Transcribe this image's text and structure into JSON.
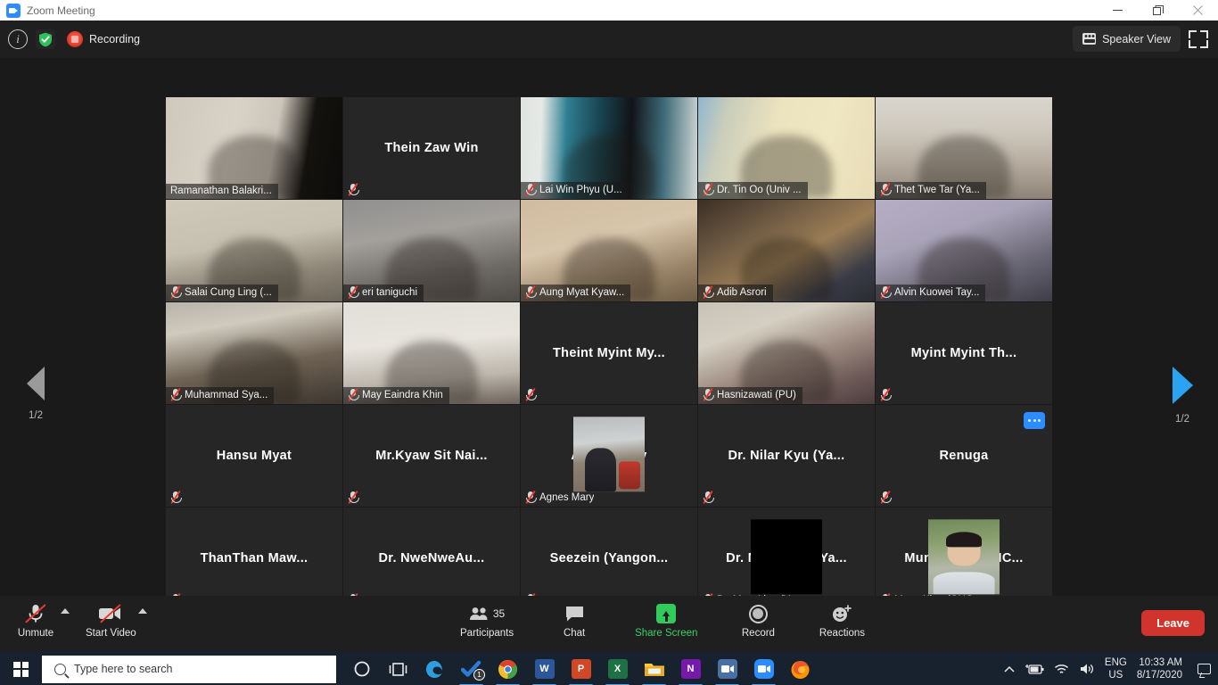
{
  "window": {
    "title": "Zoom Meeting",
    "minimize_label": "Minimize",
    "restore_label": "Restore",
    "close_label": "Close"
  },
  "header": {
    "info_icon": "info-icon",
    "encryption_icon": "shield-icon",
    "recording_label": "Recording",
    "view_mode_label": "Speaker View",
    "fullscreen_label": "Enter Full Screen"
  },
  "pager": {
    "prev_label": "1/2",
    "next_label": "1/2"
  },
  "gallery": {
    "more_options_label": "More options",
    "tiles": [
      {
        "name": "Ramanathan Balakri...",
        "video": true,
        "active": true,
        "muted": false,
        "label_shaded": true,
        "bg": "room-light"
      },
      {
        "name": "Thein Zaw Win",
        "video": false,
        "active": false,
        "muted": true,
        "label_shaded": false,
        "bg": "none"
      },
      {
        "name": "Lai Win Phyu (U...",
        "video": true,
        "active": false,
        "muted": true,
        "label_shaded": true,
        "bg": "room-teal"
      },
      {
        "name": "Dr. Tin Oo (Univ ...",
        "video": true,
        "active": false,
        "muted": true,
        "label_shaded": true,
        "bg": "room-cream"
      },
      {
        "name": "Thet Twe Tar (Ya...",
        "video": true,
        "active": false,
        "muted": true,
        "label_shaded": true,
        "bg": "room-office"
      },
      {
        "name": "Salai Cung Ling (...",
        "video": true,
        "active": false,
        "muted": true,
        "label_shaded": true,
        "bg": "room-wall"
      },
      {
        "name": "eri taniguchi",
        "video": true,
        "active": false,
        "muted": true,
        "label_shaded": true,
        "bg": "room-grey"
      },
      {
        "name": "Aung Myat Kyaw...",
        "video": true,
        "active": false,
        "muted": true,
        "label_shaded": true,
        "bg": "room-warm"
      },
      {
        "name": "Adib Asrori",
        "video": true,
        "active": false,
        "muted": true,
        "label_shaded": true,
        "bg": "room-dark"
      },
      {
        "name": "Alvin Kuowei Tay...",
        "video": true,
        "active": false,
        "muted": true,
        "label_shaded": true,
        "bg": "room-purple"
      },
      {
        "name": "Muhammad Sya...",
        "video": true,
        "active": false,
        "muted": true,
        "label_shaded": true,
        "bg": "room-class"
      },
      {
        "name": "May Eaindra Khin",
        "video": true,
        "active": false,
        "muted": true,
        "label_shaded": true,
        "bg": "room-white"
      },
      {
        "name": "Theint Myint My...",
        "video": false,
        "active": false,
        "muted": true,
        "label_shaded": false,
        "bg": "none"
      },
      {
        "name": "Hasnizawati (PU)",
        "video": true,
        "active": false,
        "muted": true,
        "label_shaded": true,
        "bg": "room-lab"
      },
      {
        "name": "Myint Myint Th...",
        "video": false,
        "active": false,
        "muted": true,
        "label_shaded": false,
        "bg": "none",
        "center_name": true
      },
      {
        "name": "Hansu Myat",
        "video": false,
        "active": false,
        "muted": true,
        "label_shaded": false,
        "bg": "none",
        "center_name": true
      },
      {
        "name": "Mr.Kyaw Sit Nai...",
        "video": false,
        "active": false,
        "muted": true,
        "label_shaded": false,
        "bg": "none",
        "center_name": true
      },
      {
        "name": "Agnes Mary",
        "video": false,
        "active": false,
        "muted": true,
        "label_shaded": false,
        "bg": "none",
        "avatar": "photo-campus"
      },
      {
        "name": "Dr. Nilar Kyu (Ya...",
        "video": false,
        "active": false,
        "muted": true,
        "label_shaded": false,
        "bg": "none",
        "center_name": true
      },
      {
        "name": "Renuga",
        "video": false,
        "active": false,
        "muted": true,
        "label_shaded": false,
        "bg": "none",
        "center_name": true,
        "more_menu": true
      },
      {
        "name": "ThanThan Maw...",
        "video": false,
        "active": false,
        "muted": true,
        "label_shaded": false,
        "bg": "none",
        "center_name": true
      },
      {
        "name": "Dr. NweNweAu...",
        "video": false,
        "active": false,
        "muted": true,
        "label_shaded": false,
        "bg": "none",
        "center_name": true
      },
      {
        "name": "Seezein (Yangon...",
        "video": false,
        "active": false,
        "muted": true,
        "label_shaded": false,
        "bg": "none",
        "center_name": true
      },
      {
        "name": "Dr. Myot Linn (Ya...",
        "video": false,
        "active": false,
        "muted": true,
        "label_shaded": false,
        "bg": "none",
        "avatar": "black-box"
      },
      {
        "name": "Mung Khat (GHC...",
        "video": false,
        "active": false,
        "muted": true,
        "label_shaded": false,
        "bg": "none",
        "avatar": "photo-man"
      }
    ]
  },
  "controls": {
    "mute": {
      "label": "Unmute",
      "icon": "microphone-muted-icon"
    },
    "video": {
      "label": "Start Video",
      "icon": "video-off-icon"
    },
    "participants": {
      "label": "Participants",
      "count": "35",
      "icon": "people-icon"
    },
    "chat": {
      "label": "Chat",
      "icon": "chat-bubble-icon"
    },
    "share": {
      "label": "Share Screen",
      "icon": "share-screen-icon",
      "color": "#3ad06a"
    },
    "record": {
      "label": "Record",
      "icon": "record-circle-icon"
    },
    "reactions": {
      "label": "Reactions",
      "icon": "smiley-plus-icon"
    },
    "leave": {
      "label": "Leave",
      "color": "#d0342c"
    }
  },
  "taskbar": {
    "start_label": "Start",
    "search_placeholder": "Type here to search",
    "cortana_label": "Cortana",
    "taskview_label": "Task View",
    "apps": [
      {
        "name": "edge-icon",
        "glyph": "e",
        "color": "#1a8ad4",
        "open": false,
        "badge": ""
      },
      {
        "name": "todo-icon",
        "glyph": "✔",
        "color": "#2b7cd3",
        "open": true,
        "badge": "1"
      },
      {
        "name": "chrome-icon",
        "glyph": "",
        "color": "#e64b3c",
        "open": true,
        "badge": ""
      },
      {
        "name": "word-icon",
        "glyph": "W",
        "color": "#2b579a",
        "open": true,
        "badge": ""
      },
      {
        "name": "powerpoint-icon",
        "glyph": "P",
        "color": "#d24726",
        "open": true,
        "badge": ""
      },
      {
        "name": "excel-icon",
        "glyph": "X",
        "color": "#1e7145",
        "open": true,
        "badge": ""
      },
      {
        "name": "file-explorer-icon",
        "glyph": "",
        "color": "#ffc83d",
        "open": true,
        "badge": ""
      },
      {
        "name": "onenote-icon",
        "glyph": "N",
        "color": "#7719aa",
        "open": true,
        "badge": ""
      },
      {
        "name": "zoom-app-icon",
        "glyph": "",
        "color": "#4a6fa5",
        "open": true,
        "badge": ""
      },
      {
        "name": "zoom-meeting-icon",
        "glyph": "",
        "color": "#2d8cff",
        "open": true,
        "badge": ""
      },
      {
        "name": "firefox-icon",
        "glyph": "",
        "color": "#e86a22",
        "open": false,
        "badge": ""
      }
    ],
    "tray": {
      "show_hidden_label": "Show hidden icons",
      "battery_label": "Battery",
      "network_label": "Network",
      "volume_label": "Volume",
      "language_line1": "ENG",
      "language_line2": "US",
      "time": "10:33 AM",
      "date": "8/17/2020",
      "notifications_label": "Notifications"
    }
  }
}
